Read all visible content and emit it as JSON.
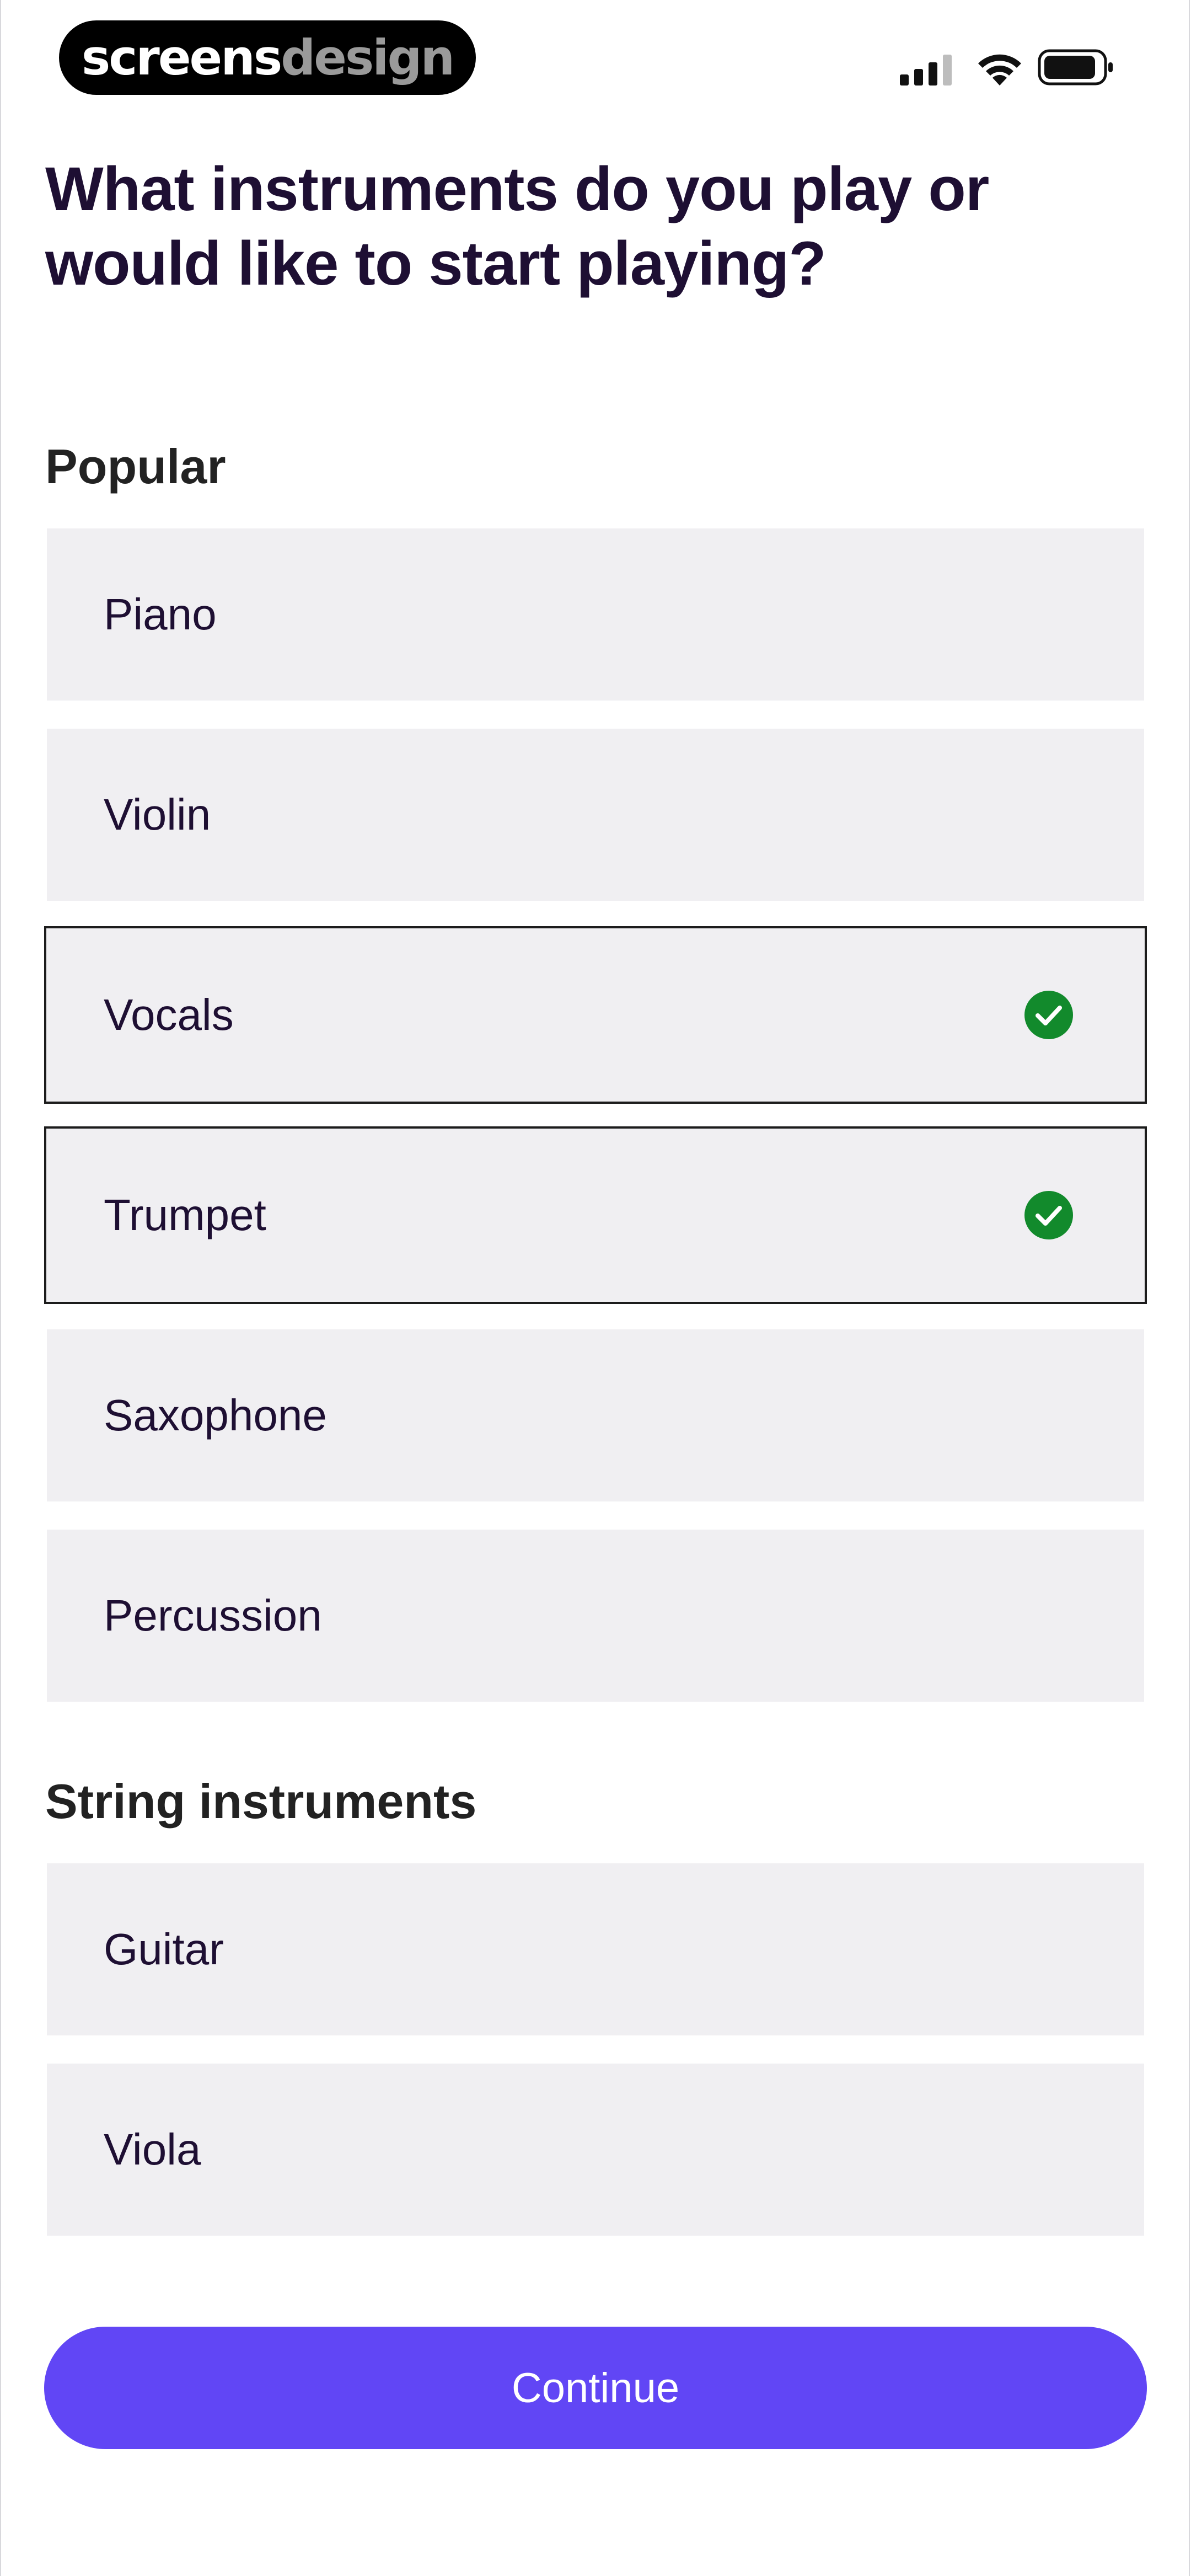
{
  "status_bar": {
    "logo_primary": "screens",
    "logo_secondary": "design",
    "icons": [
      "cellular-signal-icon",
      "wifi-icon",
      "battery-icon"
    ]
  },
  "header": {
    "title": "What instruments do you play or would like to start playing?"
  },
  "sections": [
    {
      "heading": "Popular",
      "options": [
        {
          "label": "Piano",
          "selected": false
        },
        {
          "label": "Violin",
          "selected": false
        },
        {
          "label": "Vocals",
          "selected": true
        },
        {
          "label": "Trumpet",
          "selected": true
        },
        {
          "label": "Saxophone",
          "selected": false
        },
        {
          "label": "Percussion",
          "selected": false
        }
      ]
    },
    {
      "heading": "String instruments",
      "options": [
        {
          "label": "Guitar",
          "selected": false
        },
        {
          "label": "Viola",
          "selected": false
        }
      ]
    }
  ],
  "footer": {
    "continue_label": "Continue"
  },
  "colors": {
    "accent": "#6146f5",
    "check": "#128a2c",
    "title": "#1e0f33",
    "option_bg": "#f0eff2"
  }
}
